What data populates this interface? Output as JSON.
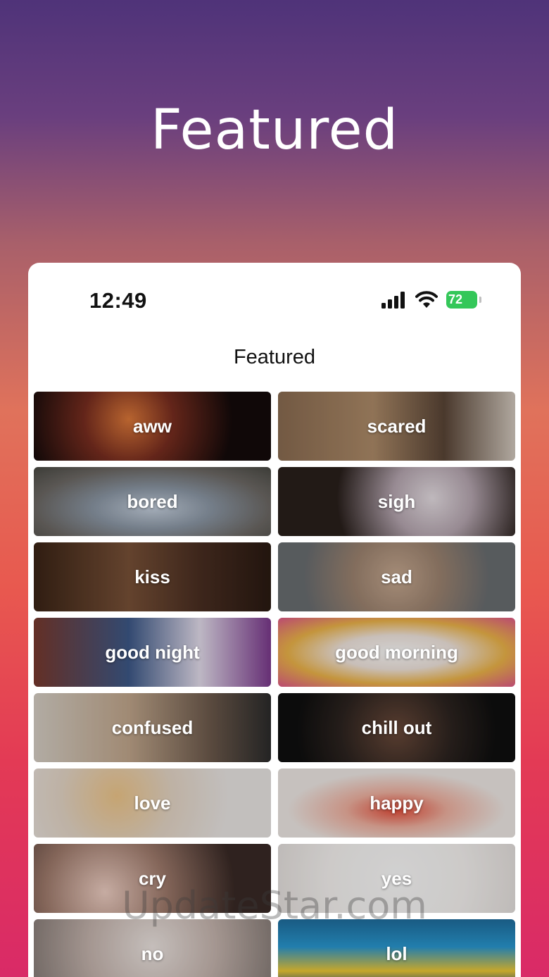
{
  "hero": {
    "title": "Featured"
  },
  "status_bar": {
    "time": "12:49",
    "battery": "72",
    "icons": [
      "cellular-signal-icon",
      "wifi-icon",
      "battery-charging-icon"
    ]
  },
  "nav": {
    "title": "Featured"
  },
  "categories": [
    {
      "label": "aww"
    },
    {
      "label": "scared"
    },
    {
      "label": "bored"
    },
    {
      "label": "sigh"
    },
    {
      "label": "kiss"
    },
    {
      "label": "sad"
    },
    {
      "label": "good night"
    },
    {
      "label": "good morning"
    },
    {
      "label": "confused"
    },
    {
      "label": "chill out"
    },
    {
      "label": "love"
    },
    {
      "label": "happy"
    },
    {
      "label": "cry"
    },
    {
      "label": "yes"
    },
    {
      "label": "no"
    },
    {
      "label": "lol"
    }
  ],
  "watermark": "UpdateStar.com",
  "colors": {
    "battery": "#34c759",
    "background_top": "#4f3379",
    "background_bottom": "#d92a67"
  }
}
